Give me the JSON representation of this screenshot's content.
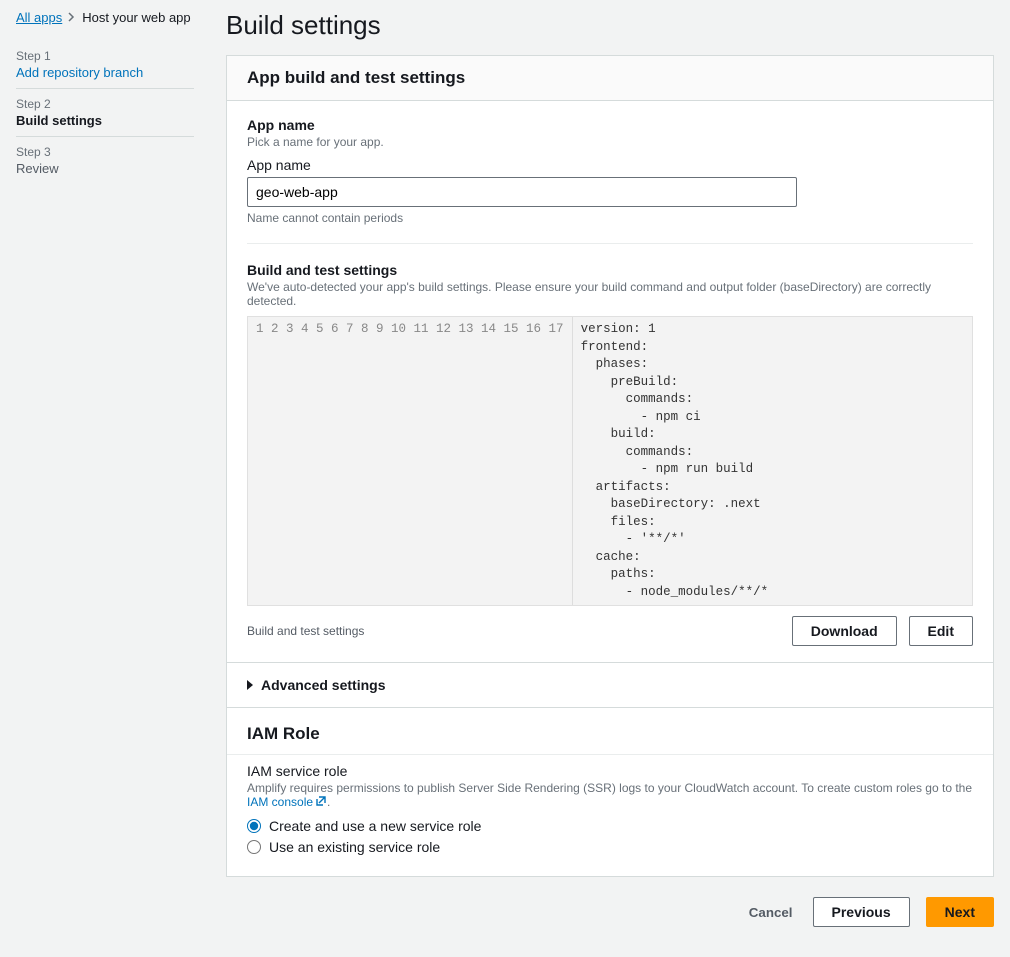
{
  "breadcrumb": {
    "root": "All apps",
    "current": "Host your web app"
  },
  "steps": [
    {
      "num": "Step 1",
      "label": "Add repository branch",
      "state": "link"
    },
    {
      "num": "Step 2",
      "label": "Build settings",
      "state": "active"
    },
    {
      "num": "Step 3",
      "label": "Review",
      "state": "pending"
    }
  ],
  "page": {
    "title": "Build settings"
  },
  "settings_panel": {
    "header": "App build and test settings",
    "app_name_section": {
      "title": "App name",
      "desc": "Pick a name for your app.",
      "field_label": "App name",
      "value": "geo-web-app",
      "hint": "Name cannot contain periods"
    },
    "build_section": {
      "title": "Build and test settings",
      "desc": "We've auto-detected your app's build settings. Please ensure your build command and output folder (baseDirectory) are correctly detected.",
      "code_lines": [
        "version: 1",
        "frontend:",
        "  phases:",
        "    preBuild:",
        "      commands:",
        "        - npm ci",
        "    build:",
        "      commands:",
        "        - npm run build",
        "  artifacts:",
        "    baseDirectory: .next",
        "    files:",
        "      - '**/*'",
        "  cache:",
        "    paths:",
        "      - node_modules/**/*",
        ""
      ],
      "footer_label": "Build and test settings",
      "download_btn": "Download",
      "edit_btn": "Edit"
    },
    "advanced": "Advanced settings"
  },
  "iam_panel": {
    "header": "IAM Role",
    "section_title": "IAM service role",
    "desc_prefix": "Amplify requires permissions to publish Server Side Rendering (SSR) logs to your CloudWatch account. To create custom roles go to the ",
    "link_text": "IAM console",
    "desc_suffix": ".",
    "radio_new": "Create and use a new service role",
    "radio_existing": "Use an existing service role"
  },
  "actions": {
    "cancel": "Cancel",
    "previous": "Previous",
    "next": "Next"
  }
}
